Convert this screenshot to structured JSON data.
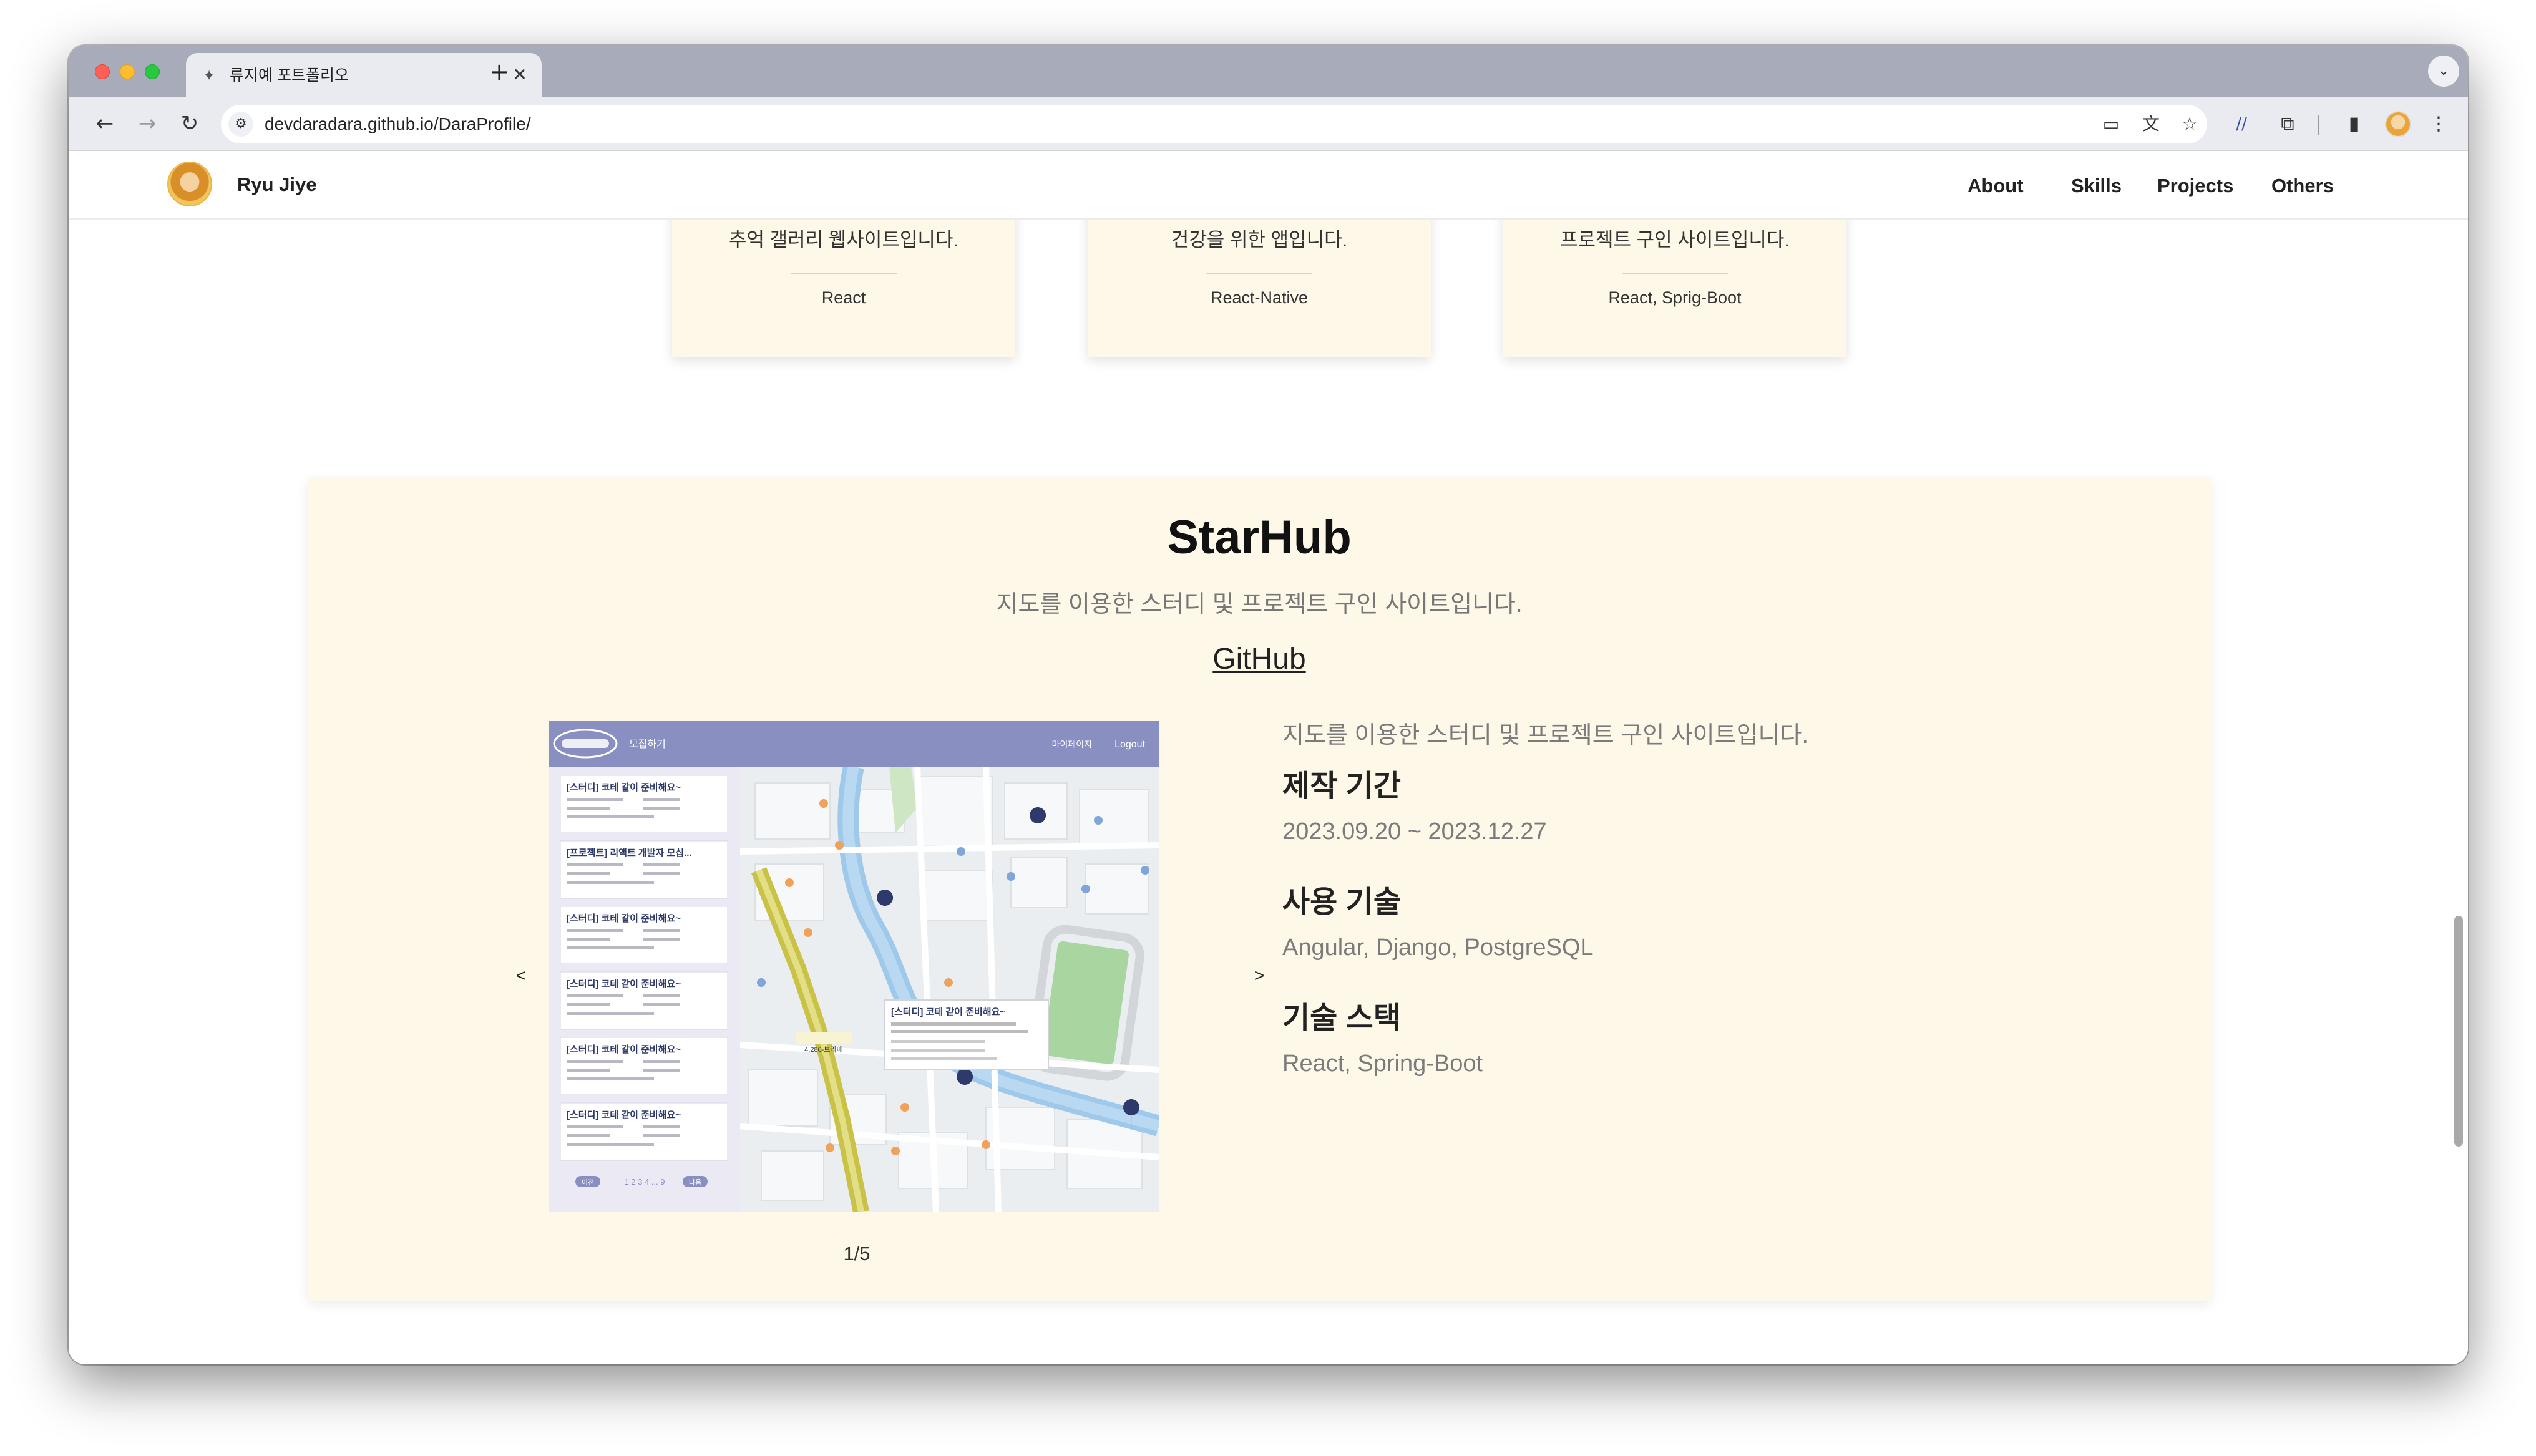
{
  "browser": {
    "tab_title": "류지예 포트폴리오",
    "tab_close": "✕",
    "new_tab": "+",
    "tab_menu": "⌄",
    "url": "devdaradara.github.io/DaraProfile/",
    "nav": {
      "back": "←",
      "forward": "→",
      "reload": "↻",
      "site_info": "⚙"
    },
    "icons": {
      "cast": "▭",
      "translate": "文",
      "bookmark": "☆",
      "extension_a": "∕∕",
      "extensions": "⧉",
      "sidepanel": "▮",
      "menu": "⋮"
    }
  },
  "site": {
    "name": "Ryu Jiye",
    "nav": [
      "About",
      "Skills",
      "Projects",
      "Others"
    ]
  },
  "top_cards": [
    {
      "description": "추억 갤러리 웹사이트입니다.",
      "tech": "React"
    },
    {
      "description": "건강을 위한 앱입니다.",
      "tech": "React-Native"
    },
    {
      "description": "프로젝트 구인 사이트입니다.",
      "tech": "React, Sprig-Boot"
    }
  ],
  "project": {
    "title": "StarHub",
    "subtitle": "지도를 이용한 스터디 및 프로젝트 구인 사이트입니다.",
    "link_label": "GitHub",
    "prev_arrow": "<",
    "next_arrow": ">",
    "slide_counter": "1/5",
    "description": "지도를 이용한 스터디 및 프로젝트 구인 사이트입니다.",
    "period_label": "제작 기간",
    "period_value": "2023.09.20 ~ 2023.12.27",
    "used_tech_label": "사용 기술",
    "used_tech_value": "Angular, Django, PostgreSQL",
    "stack_label": "기술 스택",
    "stack_value": "React, Spring-Boot",
    "screenshot": {
      "nav_menu": "모집하기",
      "nav_right_1": "마이페이지",
      "nav_right_2": "Logout",
      "list_titles": [
        "[스터디] 코테 같이 준비해요~",
        "[프로젝트] 리액트 개발자 모십...",
        "[스터디] 코테 같이 준비해요~",
        "[스터디] 코테 같이 준비해요~",
        "[스터디] 코테 같이 준비해요~",
        "[스터디] 코테 같이 준비해요~"
      ],
      "popup_title": "[스터디] 코테 같이 준비해요~",
      "pagination_prev": "이전",
      "pagination_pages": "1 2 3 4 ... 9",
      "pagination_next": "다음"
    }
  },
  "colors": {
    "card_bg": "#fdf8e8",
    "screenshot_nav": "#8a8fc2",
    "map_park": "#a8d5a0",
    "map_river": "#9ec9ea",
    "map_marker": "#2e3a6b"
  }
}
